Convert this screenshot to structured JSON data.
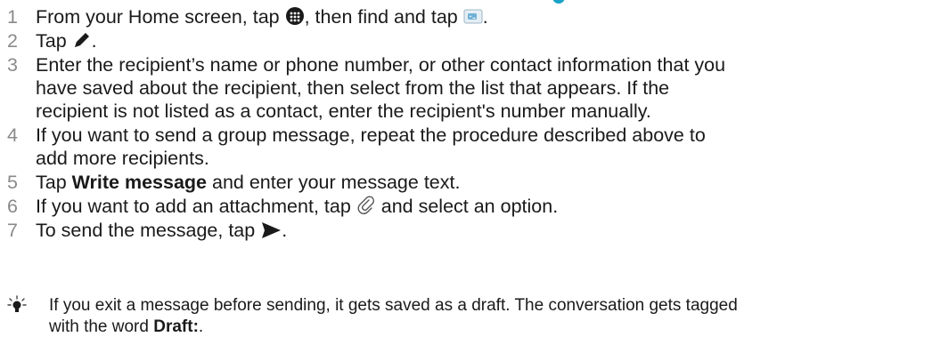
{
  "steps": [
    {
      "num": "1",
      "parts": {
        "a": "From your Home screen, tap ",
        "b": ", then find and tap ",
        "c": "."
      }
    },
    {
      "num": "2",
      "parts": {
        "a": "Tap ",
        "b": "."
      }
    },
    {
      "num": "3",
      "lines": [
        "Enter the recipient’s name or phone number, or other contact information that you",
        "have saved about the recipient, then select from the list that appears. If the",
        "recipient is not listed as a contact, enter the recipient's number manually."
      ]
    },
    {
      "num": "4",
      "lines": [
        "If you want to send a group message, repeat the procedure described above to",
        "add more recipients."
      ]
    },
    {
      "num": "5",
      "parts": {
        "a": "Tap ",
        "bold": "Write message",
        "b": " and enter your message text."
      }
    },
    {
      "num": "6",
      "parts": {
        "a": "If you want to add an attachment, tap ",
        "b": " and select an option."
      }
    },
    {
      "num": "7",
      "parts": {
        "a": "To send the message, tap ",
        "b": "."
      }
    }
  ],
  "tip": {
    "line1": "If you exit a message before sending, it gets saved as a draft. The conversation gets tagged",
    "line2_a": "with the word ",
    "line2_bold": "Draft:",
    "line2_b": "."
  },
  "icons": {
    "apps": "apps-grid-icon",
    "messaging": "messaging-app-icon",
    "compose": "pencil-compose-icon",
    "attach": "paperclip-attach-icon",
    "send": "send-arrow-icon",
    "tip": "lightbulb-tip-icon"
  },
  "colors": {
    "text": "#1a1a1a",
    "number": "#8a8a8a",
    "accent": "#1aa3c8"
  }
}
